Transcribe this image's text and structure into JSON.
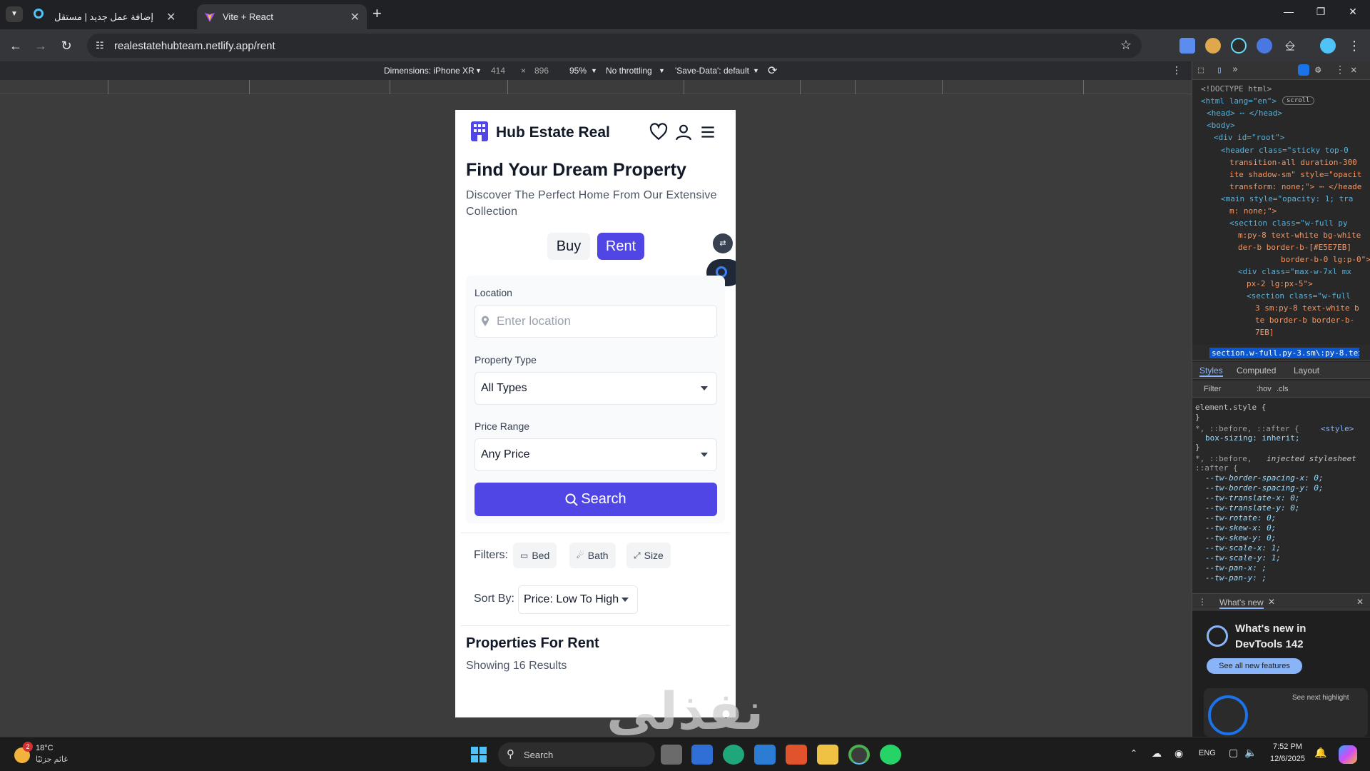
{
  "browser": {
    "tabs": [
      {
        "title": "إضافة عمل جديد | مستقل",
        "active": false
      },
      {
        "title": "Vite + React",
        "active": true
      }
    ],
    "new_tab": "+",
    "url": "realestatehubteam.netlify.app/rent"
  },
  "device_toolbar": {
    "dimensions": "Dimensions: iPhone XR",
    "width": "414",
    "x": "×",
    "height": "896",
    "zoom": "95%",
    "throttling": "No throttling",
    "save_data": "'Save-Data': default"
  },
  "app": {
    "brand": "Hub Estate Real",
    "hero_title": "Find Your Dream Property",
    "hero_subtitle": "Discover The Perfect Home From Our Extensive Collection",
    "mode_buy": "Buy",
    "mode_rent": "Rent",
    "active_mode": "Rent",
    "location_label": "Location",
    "location_placeholder": "Enter location",
    "property_type_label": "Property Type",
    "property_type_value": "All Types",
    "price_range_label": "Price Range",
    "price_range_value": "Any Price",
    "search_label": "Search",
    "filters_label": "Filters:",
    "filter_bed": "Bed",
    "filter_bath": "Bath",
    "filter_size": "Size",
    "sort_label": "Sort By:",
    "sort_value": "Price: Low To High",
    "results_title": "Properties For Rent",
    "results_count": "Showing 16 Results",
    "accent": "#4f46e5"
  },
  "devtools": {
    "dom": [
      "<!DOCTYPE html>",
      "<html lang=\"en\">",
      "scroll",
      "<head> ⋯ </head>",
      "<body>",
      "<div id=\"root\">",
      "<header class=\"sticky top-0",
      "transition-all duration-300",
      "ite shadow-sm\" style=\"opacit",
      "transform: none;\"> ⋯ </heade",
      "<main style=\"opacity: 1; tra",
      "m: none;\">",
      "<section class=\"w-full  py",
      "m:py-8 text-white bg-white",
      "der-b border-b-[#E5E7EB]",
      "border-b-0 lg:p-0\">",
      "<div class=\"max-w-7xl mx",
      "px-2 lg:px-5\">",
      "<section class=\"w-full",
      "3 sm:py-8 text-white b",
      "te  border-b border-b-",
      "7EB]"
    ],
    "breadcrumb": "section.w-full.py-3.sm\\:py-8.text-whit",
    "tabs": [
      "Styles",
      "Computed",
      "Layout"
    ],
    "filter": "Filter",
    "hov": ":hov",
    "cls": ".cls",
    "css": [
      "element.style {",
      "}",
      "*, ::before, ::after {",
      "<style>",
      "box-sizing: inherit;",
      "}",
      "*, ::before,",
      "injected stylesheet",
      "::after {",
      "--tw-border-spacing-x: 0;",
      "--tw-border-spacing-y: 0;",
      "--tw-translate-x: 0;",
      "--tw-translate-y: 0;",
      "--tw-rotate: 0;",
      "--tw-skew-x: 0;",
      "--tw-skew-y: 0;",
      "--tw-scale-x: 1;",
      "--tw-scale-y: 1;",
      "--tw-pan-x: ;",
      "--tw-pan-y: ;"
    ],
    "drawer_tab": "What's new",
    "whats_new_title": "What's new in DevTools 142",
    "see_all": "See all new features",
    "see_next": "See next highlight"
  },
  "taskbar": {
    "weather_temp": "18°C",
    "weather_desc": "غائم جزئيًا",
    "weather_badge": "2",
    "search": "Search",
    "language": "ENG",
    "time": "7:52 PM",
    "date": "12/6/2025"
  },
  "watermark": "نفذلي"
}
